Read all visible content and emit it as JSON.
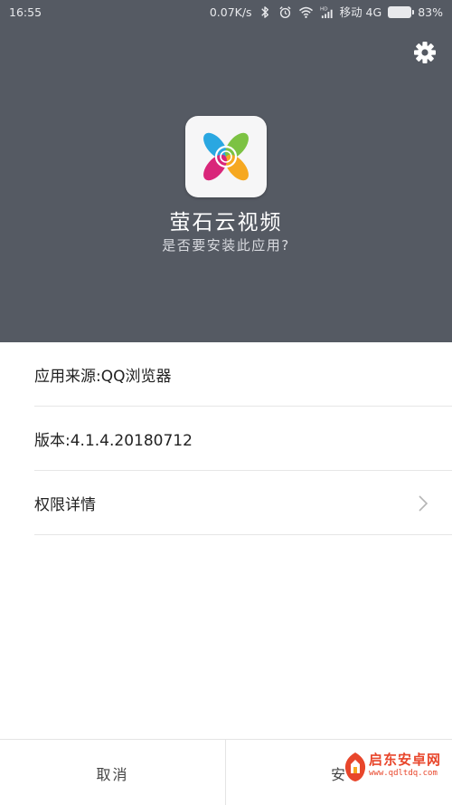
{
  "status_bar": {
    "time": "16:55",
    "speed": "0.07K/s",
    "carrier": "移动 4G",
    "battery": "83%",
    "network_badge": "HD"
  },
  "header": {
    "app_name": "萤石云视频",
    "install_question": "是否要安装此应用?"
  },
  "info": {
    "source": "应用来源:QQ浏览器",
    "version": "版本:4.1.4.20180712",
    "permissions": "权限详情"
  },
  "buttons": {
    "cancel": "取消",
    "install": "安"
  },
  "watermark": {
    "name": "启东安卓网",
    "url": "www.qdltdq.com"
  },
  "colors": {
    "header_bg": "#555a63",
    "watermark": "#e8462b"
  }
}
